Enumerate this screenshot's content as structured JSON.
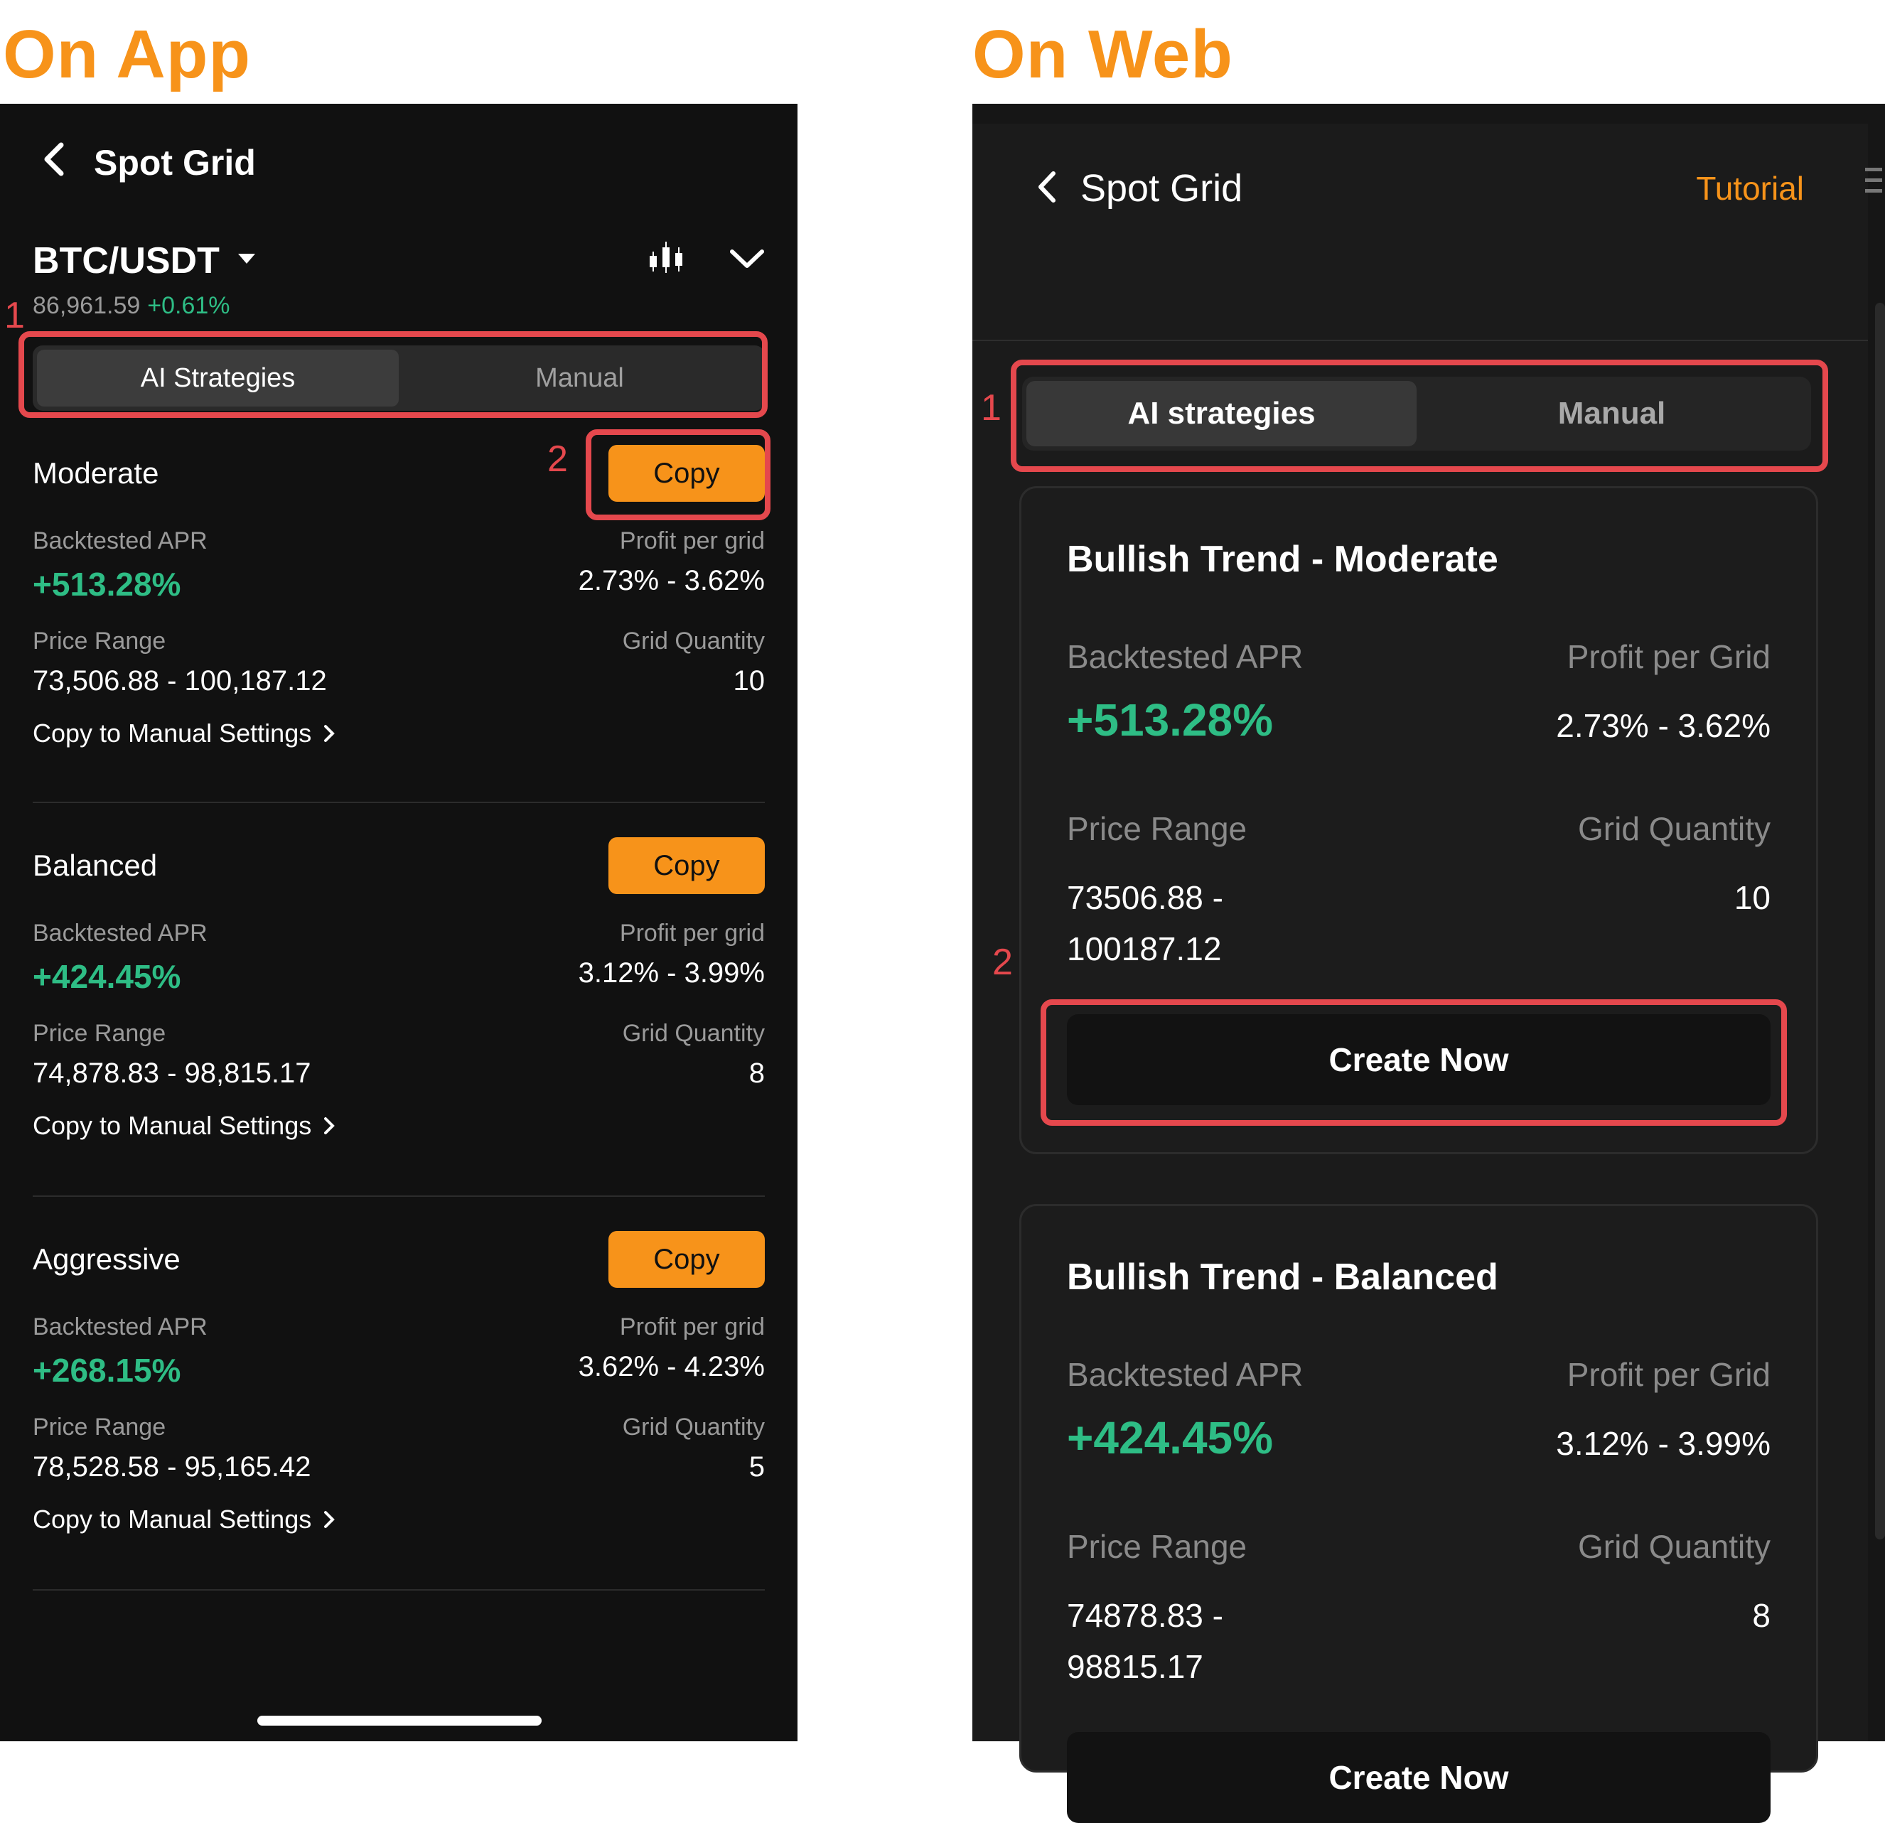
{
  "labels": {
    "app": "On App",
    "web": "On Web"
  },
  "colors": {
    "accent": "#f7931a",
    "positive": "#2ebd85",
    "highlight": "#e5484d"
  },
  "app": {
    "title": "Spot Grid",
    "pair": "BTC/USDT",
    "price": "86,961.59",
    "change": "+0.61%",
    "tabs": [
      "AI Strategies",
      "Manual"
    ],
    "annotation_1": "1",
    "annotation_2": "2",
    "strategies": [
      {
        "name": "Moderate",
        "copy_label": "Copy",
        "apr_label": "Backtested APR",
        "apr": "+513.28%",
        "ppg_label": "Profit per grid",
        "ppg": "2.73% - 3.62%",
        "range_label": "Price Range",
        "range": "73,506.88 - 100,187.12",
        "qty_label": "Grid Quantity",
        "qty": "10",
        "link": "Copy to Manual Settings"
      },
      {
        "name": "Balanced",
        "copy_label": "Copy",
        "apr_label": "Backtested APR",
        "apr": "+424.45%",
        "ppg_label": "Profit per grid",
        "ppg": "3.12% - 3.99%",
        "range_label": "Price Range",
        "range": "74,878.83 - 98,815.17",
        "qty_label": "Grid Quantity",
        "qty": "8",
        "link": "Copy to Manual Settings"
      },
      {
        "name": "Aggressive",
        "copy_label": "Copy",
        "apr_label": "Backtested APR",
        "apr": "+268.15%",
        "ppg_label": "Profit per grid",
        "ppg": "3.62% - 4.23%",
        "range_label": "Price Range",
        "range": "78,528.58 - 95,165.42",
        "qty_label": "Grid Quantity",
        "qty": "5",
        "link": "Copy to Manual Settings"
      }
    ]
  },
  "web": {
    "title": "Spot Grid",
    "tutorial": "Tutorial",
    "tabs": [
      "AI strategies",
      "Manual"
    ],
    "annotation_1": "1",
    "annotation_2": "2",
    "cards": [
      {
        "title": "Bullish Trend - Moderate",
        "apr_label": "Backtested APR",
        "apr": "+513.28%",
        "ppg_label": "Profit per Grid",
        "ppg": "2.73% - 3.62%",
        "range_label": "Price Range",
        "range_low": "73506.88 -",
        "range_high": "100187.12",
        "qty_label": "Grid Quantity",
        "qty": "10",
        "button": "Create Now"
      },
      {
        "title": "Bullish Trend - Balanced",
        "apr_label": "Backtested APR",
        "apr": "+424.45%",
        "ppg_label": "Profit per Grid",
        "ppg": "3.12% - 3.99%",
        "range_label": "Price Range",
        "range_low": "74878.83 -",
        "range_high": "98815.17",
        "qty_label": "Grid Quantity",
        "qty": "8",
        "button": "Create Now"
      }
    ]
  }
}
